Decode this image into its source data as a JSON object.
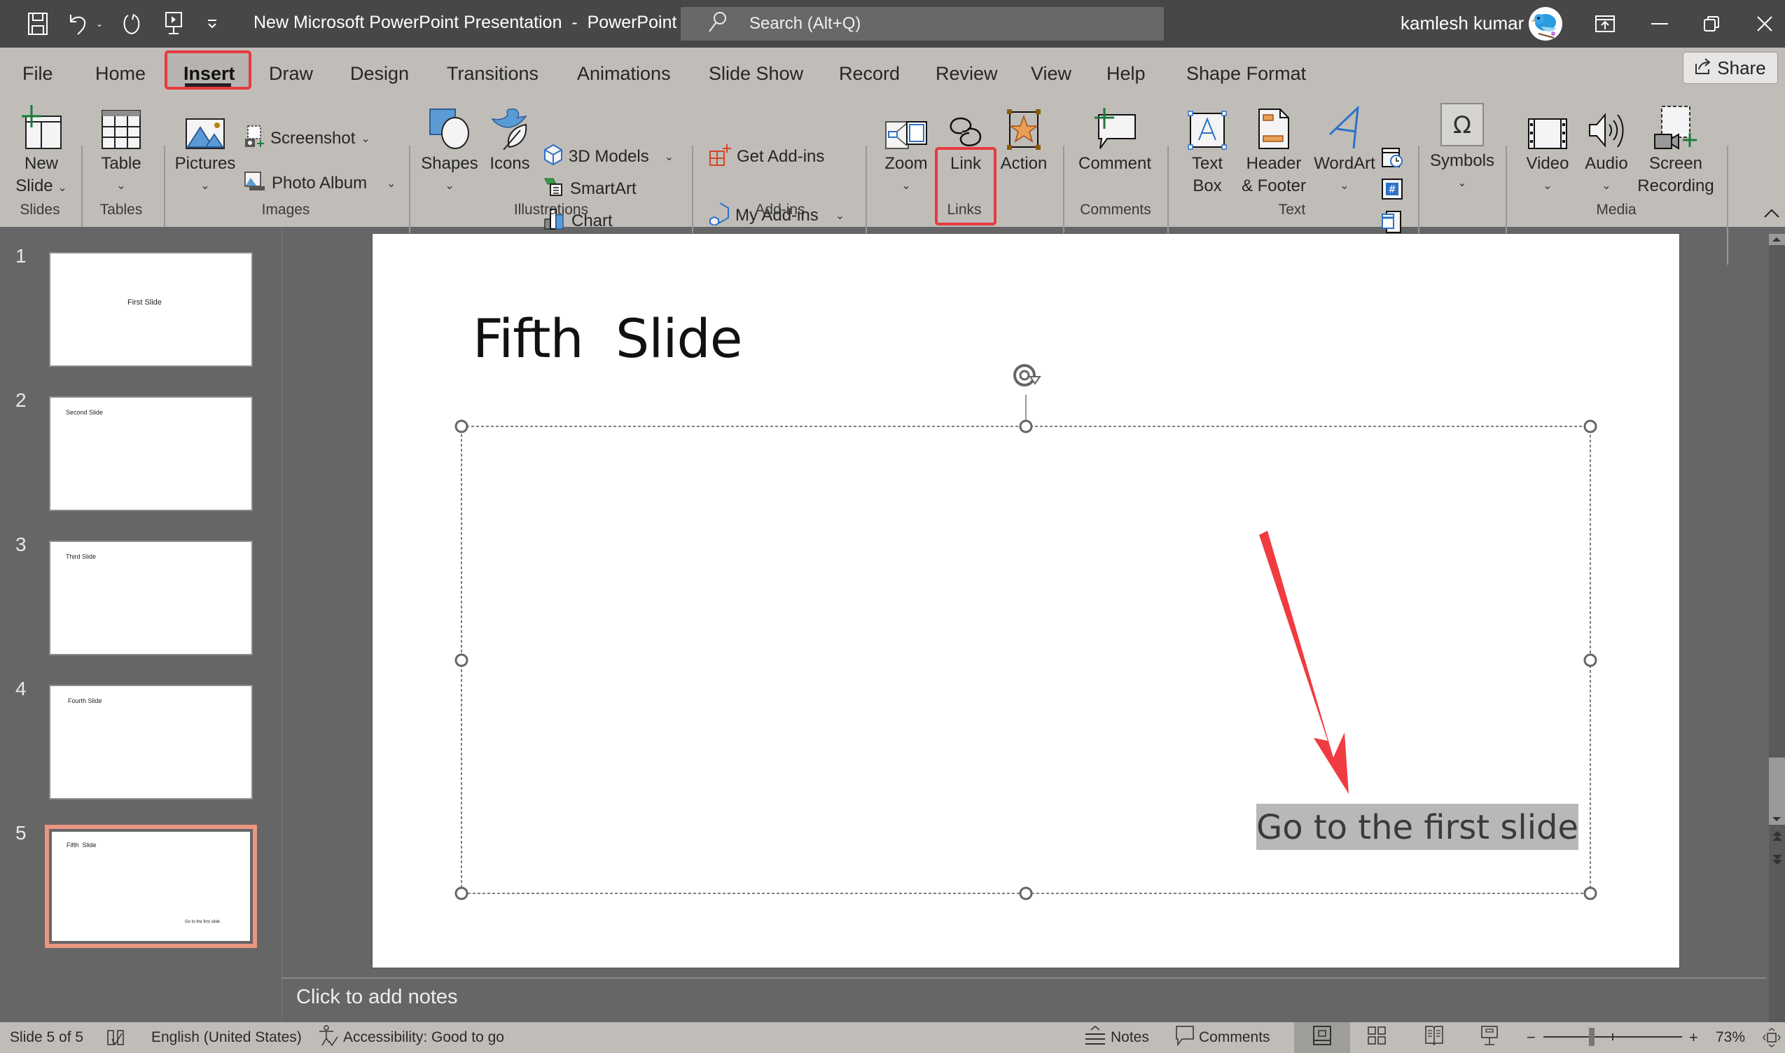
{
  "titlebar": {
    "document_title": "New Microsoft PowerPoint Presentation  -  PowerPoint",
    "search_placeholder": "Search (Alt+Q)",
    "user_name": "kamlesh kumar",
    "qat": [
      "save-icon",
      "undo-icon",
      "redo-icon",
      "present-from-beginning-icon",
      "customize-qat-icon"
    ]
  },
  "ribbon": {
    "tabs": [
      {
        "label": "File"
      },
      {
        "label": "Home"
      },
      {
        "label": "Insert",
        "active": true
      },
      {
        "label": "Draw"
      },
      {
        "label": "Design"
      },
      {
        "label": "Transitions"
      },
      {
        "label": "Animations"
      },
      {
        "label": "Slide Show"
      },
      {
        "label": "Record"
      },
      {
        "label": "Review"
      },
      {
        "label": "View"
      },
      {
        "label": "Help"
      },
      {
        "label": "Shape Format"
      }
    ],
    "share_label": "Share",
    "groups": {
      "slides": {
        "label": "Slides",
        "new_slide_1": "New",
        "new_slide_2": "Slide"
      },
      "tables": {
        "label": "Tables",
        "table": "Table"
      },
      "images": {
        "label": "Images",
        "pictures": "Pictures",
        "screenshot": "Screenshot",
        "photo_album": "Photo Album"
      },
      "illustrations": {
        "label": "Illustrations",
        "shapes": "Shapes",
        "icons": "Icons",
        "models_3d": "3D Models",
        "smartart": "SmartArt",
        "chart": "Chart"
      },
      "addins": {
        "label": "Add-ins",
        "get_addins": "Get Add-ins",
        "my_addins": "My Add-ins"
      },
      "links": {
        "label": "Links",
        "zoom": "Zoom",
        "link": "Link",
        "action": "Action"
      },
      "comments": {
        "label": "Comments",
        "comment": "Comment"
      },
      "text": {
        "label": "Text",
        "text_box_1": "Text",
        "text_box_2": "Box",
        "header_footer_1": "Header",
        "header_footer_2": "& Footer",
        "wordart": "WordArt"
      },
      "symbols": {
        "label": "",
        "symbols": "Symbols"
      },
      "media": {
        "label": "Media",
        "video": "Video",
        "audio": "Audio",
        "screen_recording_1": "Screen",
        "screen_recording_2": "Recording"
      }
    }
  },
  "thumbnails": [
    {
      "number": "1",
      "text": "First Slide"
    },
    {
      "number": "2",
      "text": "Second Slide"
    },
    {
      "number": "3",
      "text": "Third Slide"
    },
    {
      "number": "4",
      "text": "Fourth Slide"
    },
    {
      "number": "5",
      "text": "Fifth  Slide",
      "link_text": "Go to the first slide",
      "selected": true
    }
  ],
  "slide": {
    "title": "Fifth  Slide",
    "link_text": "Go to the first slide"
  },
  "notes": {
    "placeholder": "Click to add notes"
  },
  "statusbar": {
    "slide_counter": "Slide 5 of 5",
    "language": "English (United States)",
    "accessibility": "Accessibility: Good to go",
    "notes_label": "Notes",
    "comments_label": "Comments",
    "zoom_level": "73%",
    "zoom_value_percent": 73
  },
  "colors": {
    "highlight_red": "#e8393f",
    "selected_thumb_border": "#eb9583",
    "ribbon_bg": "#c0bdb9",
    "titlebar_bg": "#474747",
    "workspace_bg": "#666666"
  }
}
